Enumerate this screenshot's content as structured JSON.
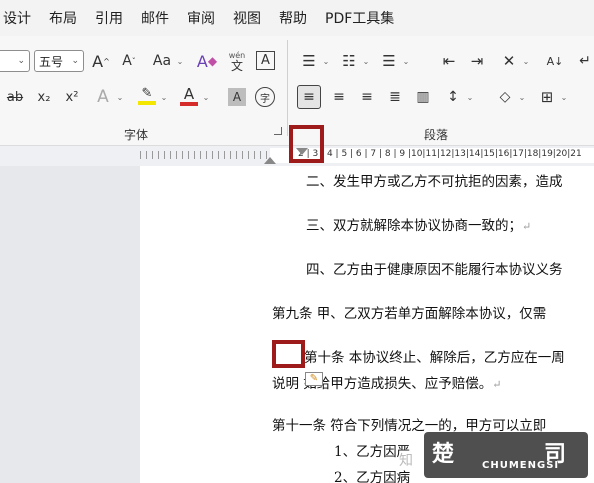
{
  "menu": [
    "设计",
    "布局",
    "引用",
    "邮件",
    "审阅",
    "视图",
    "帮助",
    "PDF工具集"
  ],
  "font": {
    "size_value": "五号",
    "grow_label": "A",
    "shrink_label": "A",
    "case_label": "Aa",
    "wen_top": "wén",
    "wen_bottom": "文",
    "border_char": "A",
    "strike_label": "ab",
    "sub_label": "x₂",
    "sup_label": "x²",
    "effects_label": "A",
    "highlight_label": "✎",
    "fontcolor_label": "A",
    "shade_label": "A",
    "circle_char": "字",
    "group_label": "字体"
  },
  "paragraph": {
    "group_label": "段落",
    "sort_label": "A↓"
  },
  "ruler": {
    "numbers": "2 | 3 | 4 | 5 | 6 | 7 | 8 | 9 |10|11|12|13|14|15|16|17|18|19|20|21"
  },
  "document": {
    "lines": [
      "二、发生甲方或乙方不可抗拒的因素，造成",
      "三、双方就解除本协议协商一致的；",
      "四、乙方由于健康原因不能履行本协议义务",
      "第九条   甲、乙双方若单方面解除本协议，仅需",
      "第十条  本协议终止、解除后，乙方应在一周",
      "说明     如给甲方造成损失、应予赔偿。",
      "第十一条    符合下列情况之一的，甲方可以立即",
      "1、乙方因严",
      "2、乙方因病"
    ],
    "return_mark": "↵"
  },
  "watermark": {
    "small_text": "CHUMENGSI",
    "char_left": "楚",
    "char_right": "司",
    "char_zhi": "知"
  },
  "colors": {
    "highlight_yellow": "#f3e600",
    "font_red": "#d62b2b",
    "annotation_red": "#9e1b1b"
  }
}
